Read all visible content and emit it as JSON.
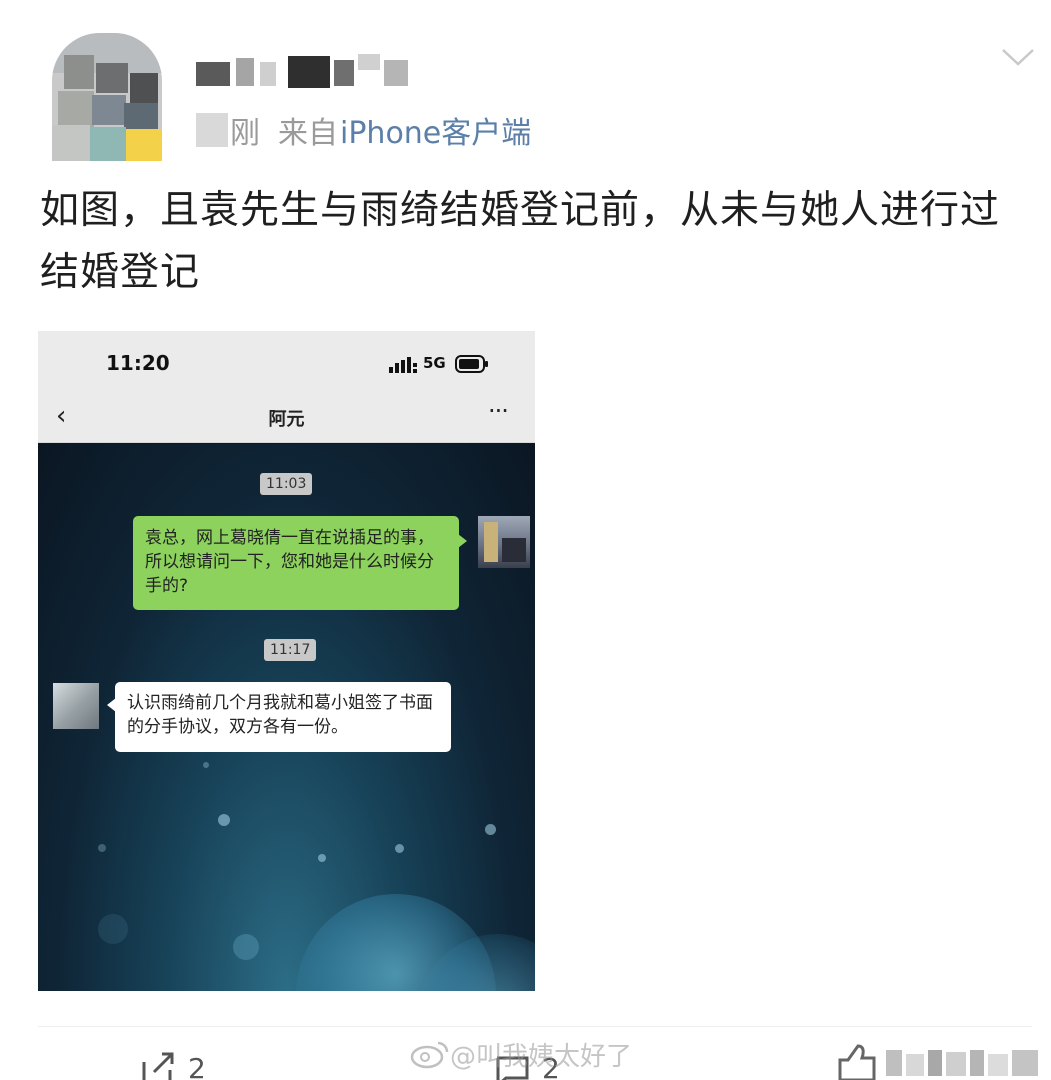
{
  "post": {
    "time_label": "刚",
    "source_prefix": "来自",
    "source_client": "iPhone客户端",
    "text": "如图，且袁先生与雨绮结婚登记前，从未与她人进行过结婚登记"
  },
  "screenshot": {
    "status_time": "11:20",
    "network": "5G",
    "contact_name": "阿元",
    "back_glyph": "‹",
    "more_glyph": "···",
    "messages": [
      {
        "timestamp": "11:03",
        "side": "right",
        "text": "袁总，网上葛晓倩一直在说插足的事，所以想请问一下，您和她是什么时候分手的?"
      },
      {
        "timestamp": "11:17",
        "side": "left",
        "text": "认识雨绮前几个月我就和葛小姐签了书面的分手协议，双方各有一份。"
      }
    ]
  },
  "footer": {
    "repost_count": "2",
    "comment_count": "2",
    "watermark": "@叫我姨太好了",
    "icons": [
      "repost-icon",
      "comment-icon",
      "like-icon",
      "weibo-logo-icon",
      "chevron-down-icon"
    ]
  },
  "colors": {
    "source_link": "#5b7fa8",
    "bubble_green": "#8cd25c",
    "meta_gray": "#9a9a9a"
  }
}
